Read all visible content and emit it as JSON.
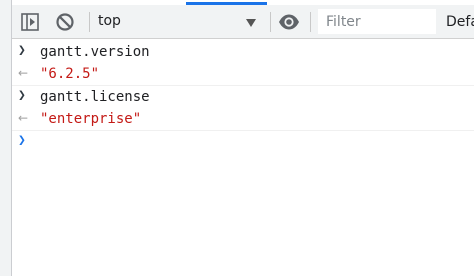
{
  "toolbar": {
    "context": "top",
    "filter_placeholder": "Filter",
    "levels_label": "Defa"
  },
  "console": {
    "entries": [
      {
        "type": "input",
        "text": "gantt.version"
      },
      {
        "type": "result",
        "text": "\"6.2.5\""
      },
      {
        "type": "input",
        "text": "gantt.license"
      },
      {
        "type": "result",
        "text": "\"enterprise\""
      }
    ]
  },
  "icons": {
    "sidebar_toggle": "sidebar-toggle-icon",
    "clear": "clear-console-icon",
    "dropdown": "chevron-down-icon",
    "live_expression": "eye-icon",
    "prompt": "chevron-right-icon",
    "result": "result-arrow-icon"
  }
}
